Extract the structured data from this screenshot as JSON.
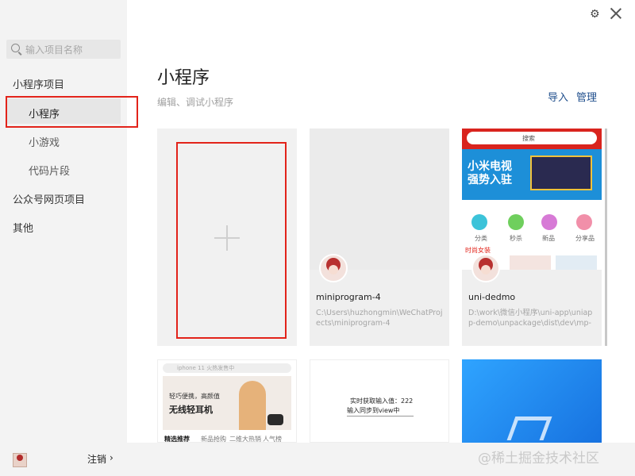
{
  "sidebar": {
    "search_placeholder": "输入项目名称",
    "section_miniprogram": "小程序项目",
    "items": [
      {
        "label": "小程序"
      },
      {
        "label": "小游戏"
      },
      {
        "label": "代码片段"
      }
    ],
    "section_official": "公众号网页项目",
    "section_other": "其他",
    "logout_label": "注销",
    "logout_chevron": "›"
  },
  "header": {
    "title": "小程序",
    "subtitle": "编辑、调试小程序",
    "import_label": "导入",
    "manage_label": "管理"
  },
  "projects": [
    {
      "name": "miniprogram-4",
      "path": "C:\\Users\\huzhongmin\\WeChatProjects\\miniprogram-4"
    },
    {
      "name": "uni-dedmo",
      "path": "D:\\work\\微信小程序\\uni-app\\uniapp-demo\\unpackage\\dist\\dev\\mp-"
    }
  ],
  "thumbs": {
    "uni_search": "搜索",
    "uni_banner_line1": "小米电视",
    "uni_banner_line2": "强势入驻",
    "uni_icons": [
      "分类",
      "秒杀"
    ],
    "uni_icons_more": [
      "新品",
      "分享品"
    ],
    "uni_section": "时尚女装",
    "shop_search": "iphone 11 火热发售中",
    "shop_banner_line1": "轻巧便携，高颜值",
    "shop_banner_line2": "无线轻耳机",
    "shop_tabs": [
      "精选推荐",
      "新品抢购",
      "二维大热销",
      "人气榜"
    ],
    "text_line1": "实时获取输入值：222",
    "text_line2": "输入同步到view中"
  },
  "watermark": "@稀土掘金技术社区",
  "colors": {
    "highlight": "#e2231a",
    "link": "#1f4e8c",
    "sidebar_bg": "#f3f3f3"
  }
}
